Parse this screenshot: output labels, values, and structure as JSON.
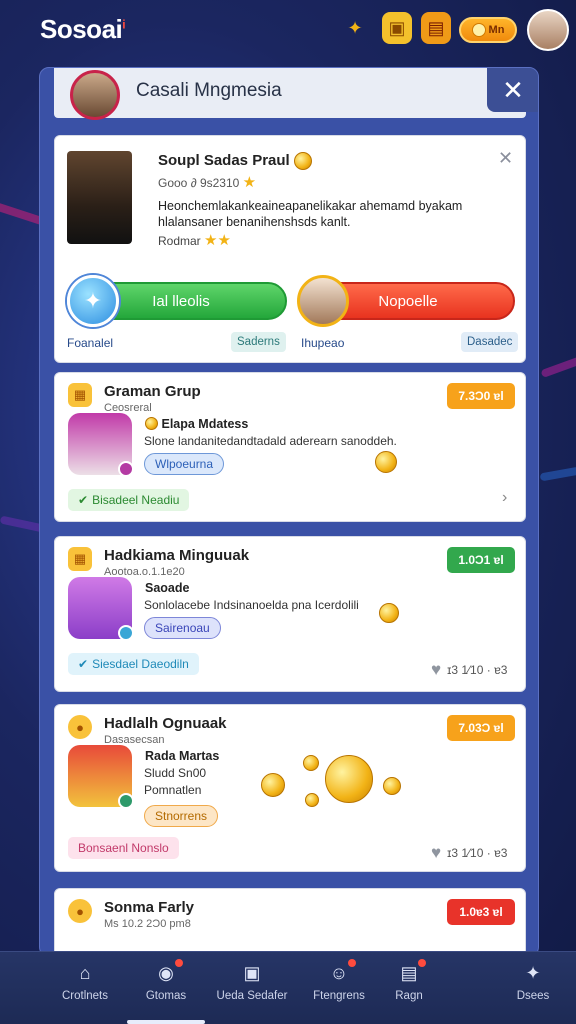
{
  "app": {
    "brand": "Sosoai",
    "brand_mark": "i"
  },
  "topbar": {
    "coin_label": "Mn"
  },
  "panel": {
    "title": "Casali Mngmesia",
    "close": "✕"
  },
  "featured": {
    "title": "Soupl Sadas Praul",
    "subtitle": "Gooo ∂ 9s2310",
    "description": "Heonchemlakankeaineapanelikakar ahemamd byakam hlalansaner benanihenshsds kanlt.",
    "rated_label": "Rodmar",
    "close": "✕",
    "accept_label": "Ial lleolis",
    "decline_label": "Nopoelle",
    "left_caption": "Foanalel",
    "left_chip": "Saderns",
    "right_caption": "Ihupeao",
    "right_chip": "Dasadec"
  },
  "items": [
    {
      "title": "Graman Grup",
      "subtitle": "Ceosreral",
      "badge": "7.3Ɔ0 ɐl",
      "badge_color": "#f7a21b",
      "name": "Elapa Mdatess",
      "desc": "Slone landanitedandtadald aderearn sanoddeh.",
      "pill": "Wlpoeurna",
      "tag": "Bisadeel Neadiu",
      "tag_color": "#3ec046"
    },
    {
      "title": "Hadkiama Minguuak",
      "subtitle": "Aootoa.o.1.1e20",
      "badge": "1.0Ɔ1 ɐl",
      "badge_color": "#32a84d",
      "name": "Saoade",
      "desc": "Sonlolacebe Indsinanoelda pna Icerdolili",
      "pill": "Sairenoau",
      "tag": "Siesdael Daeodiln",
      "tag_color": "#3cbbe4",
      "meta": "ɪ3 1⁄10 · ɐ3"
    },
    {
      "title": "Hadlalh Ognuaak",
      "subtitle": "Dasasecsan",
      "badge": "7.03Ɔ ɐl",
      "badge_color": "#f7a21b",
      "name": "Rada Martas",
      "desc": "Sludd Sn00",
      "desc2": "Pomnatlen",
      "pill": "Stnorrens",
      "tag": "Bonsaenl Nonslo",
      "tag_color": "#f06a9a",
      "meta": "ɪ3 1⁄10 · ɐ3"
    },
    {
      "title": "Sonma Farly",
      "subtitle": "Ms 10.2 2Ɔ0 pm8",
      "badge": "1.0ɐ3 ɐl",
      "badge_color": "#e8332a"
    }
  ],
  "nav": [
    {
      "label": "Crotlnets"
    },
    {
      "label": "Gtomas"
    },
    {
      "label": "Ueda Sedafer"
    },
    {
      "label": "Ftengrens"
    },
    {
      "label": "Ragn"
    },
    {
      "label": "Dsees"
    }
  ]
}
